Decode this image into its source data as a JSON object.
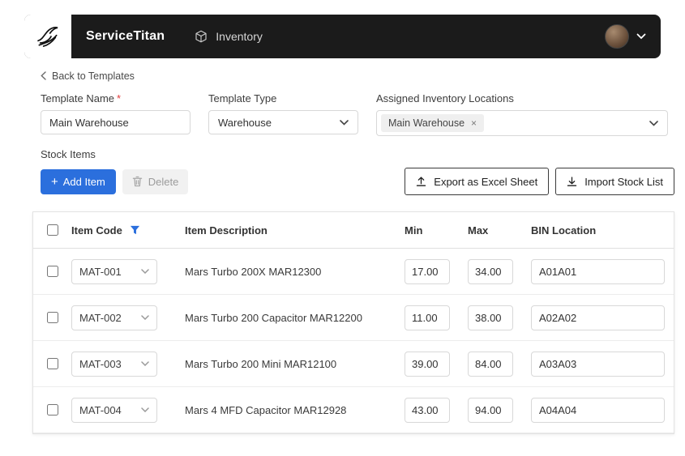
{
  "header": {
    "brand": "ServiceTitan",
    "nav_inventory": "Inventory"
  },
  "breadcrumb": {
    "back_label": "Back to Templates"
  },
  "form": {
    "template_name": {
      "label": "Template Name",
      "required_mark": "*",
      "value": "Main Warehouse"
    },
    "template_type": {
      "label": "Template Type",
      "value": "Warehouse"
    },
    "assigned_locations": {
      "label": "Assigned Inventory Locations",
      "tag": "Main Warehouse",
      "tag_remove": "×"
    }
  },
  "stock_items": {
    "section_label": "Stock Items",
    "add_button": "Add Item",
    "delete_button": "Delete",
    "export_button": "Export as Excel Sheet",
    "import_button": "Import Stock List"
  },
  "table": {
    "columns": {
      "item_code": "Item Code",
      "item_description": "Item Description",
      "min": "Min",
      "max": "Max",
      "bin_location": "BIN Location"
    },
    "rows": [
      {
        "code": "MAT-001",
        "description": "Mars Turbo 200X MAR12300",
        "min": "17.00",
        "max": "34.00",
        "bin": "A01A01"
      },
      {
        "code": "MAT-002",
        "description": "Mars Turbo 200 Capacitor MAR12200",
        "min": "11.00",
        "max": "38.00",
        "bin": "A02A02"
      },
      {
        "code": "MAT-003",
        "description": "Mars Turbo 200 Mini MAR12100",
        "min": "39.00",
        "max": "84.00",
        "bin": "A03A03"
      },
      {
        "code": "MAT-004",
        "description": "Mars 4 MFD Capacitor MAR12928",
        "min": "43.00",
        "max": "94.00",
        "bin": "A04A04"
      }
    ]
  },
  "colors": {
    "accent_blue": "#2b6fdd",
    "header_bg": "#1b1b1b",
    "required_red": "#e13c3c"
  }
}
